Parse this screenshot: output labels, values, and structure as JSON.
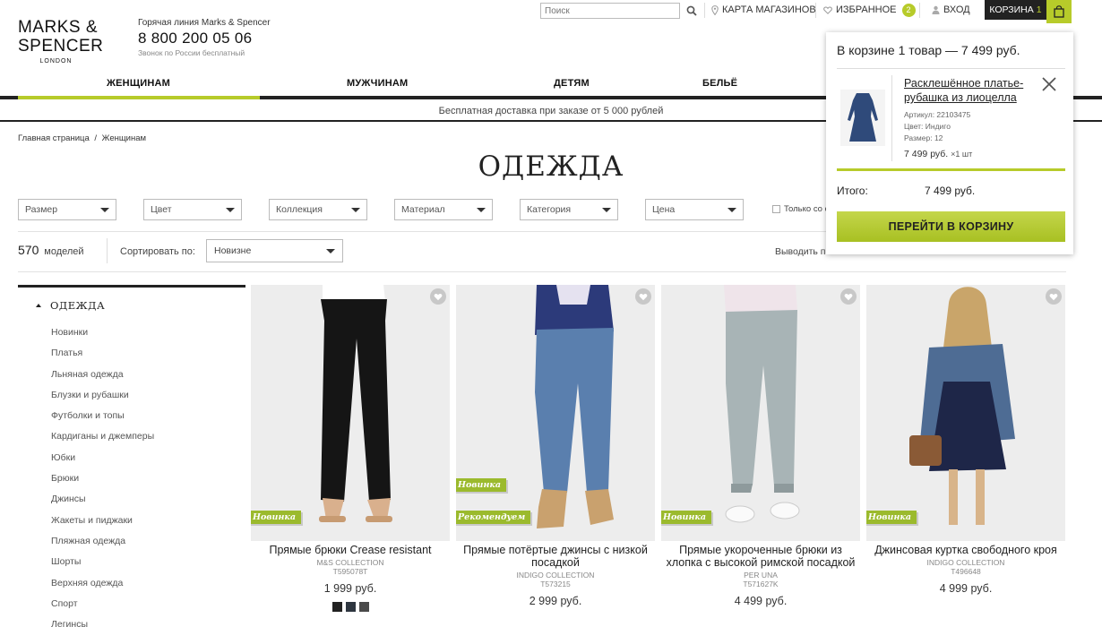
{
  "brand": {
    "line1": "MARKS &",
    "line2": "SPENCER",
    "line3": "LONDON"
  },
  "hotline": {
    "title": "Горячая линия Marks & Spencer",
    "phone": "8 800 200 05 06",
    "subtitle": "Звонок по России бесплатный"
  },
  "top": {
    "search_placeholder": "Поиск",
    "stores": "КАРТА МАГАЗИНОВ",
    "favorites": "ИЗБРАННОЕ",
    "favorites_count": "2",
    "login": "ВХОД",
    "cart": "КОРЗИНА",
    "cart_count": "1"
  },
  "nav": {
    "women": "ЖЕНЩИНАМ",
    "men": "МУЖЧИНАМ",
    "kids": "ДЕТЯМ",
    "lingerie": "БЕЛЬЁ"
  },
  "promo": "Бесплатная доставка при заказе от 5 000 рублей",
  "breadcrumbs": {
    "home": "Главная страница",
    "sep": "/",
    "current": "Женщинам"
  },
  "title": "ОДЕЖДА",
  "filters": [
    "Размер",
    "Цвет",
    "Коллекция",
    "Материал",
    "Категория",
    "Цена"
  ],
  "only_label": "Только со с",
  "listing": {
    "count": "570",
    "count_label": "моделей",
    "sort_label": "Сортировать по:",
    "sort_value": "Новизне",
    "perpage_label": "Выводить по:"
  },
  "sidebar": {
    "heading": "ОДЕЖДА",
    "items": [
      "Новинки",
      "Платья",
      "Льняная одежда",
      "Блузки и рубашки",
      "Футболки и топы",
      "Кардиганы и джемперы",
      "Юбки",
      "Брюки",
      "Джинсы",
      "Жакеты и пиджаки",
      "Пляжная одежда",
      "Шорты",
      "Верхняя одежда",
      "Спорт",
      "Легинсы"
    ]
  },
  "products": [
    {
      "name": "Прямые брюки Crease resistant",
      "collection": "M&S COLLECTION",
      "article": "T595078T",
      "price": "1 999 руб.",
      "tags": [
        "Новинка"
      ],
      "swatches": [
        "#222222",
        "#2e3640",
        "#4a4a4a"
      ]
    },
    {
      "name": "Прямые потёртые джинсы с низкой посадкой",
      "collection": "INDIGO COLLECTION",
      "article": "T573215",
      "price": "2 999 руб.",
      "tags": [
        "Новинка",
        "Рекомендуем"
      ]
    },
    {
      "name": "Прямые укороченные брюки из хлопка с высокой римской посадкой",
      "collection": "PER UNA",
      "article": "T571627K",
      "price": "4 499 руб.",
      "tags": [
        "Новинка"
      ]
    },
    {
      "name": "Джинсовая куртка свободного кроя",
      "collection": "INDIGO COLLECTION",
      "article": "T496648",
      "price": "4 999 руб.",
      "tags": [
        "Новинка"
      ]
    }
  ],
  "cart_popup": {
    "heading": "В корзине 1 товар — 7 499 руб.",
    "item_name": "Расклешённое платье-рубашка из лиоцелла",
    "article": "Артикул: 22103475",
    "color": "Цвет: Индиго",
    "size": "Размер: 12",
    "price": "7 499 руб.",
    "qty": "×1 шт",
    "total_label": "Итого:",
    "total_value": "7 499 руб.",
    "checkout": "ПЕРЕЙТИ В КОРЗИНУ"
  },
  "colors": {
    "accent": "#b7cb2a",
    "tag": "#9bba2d",
    "dark": "#222222"
  }
}
